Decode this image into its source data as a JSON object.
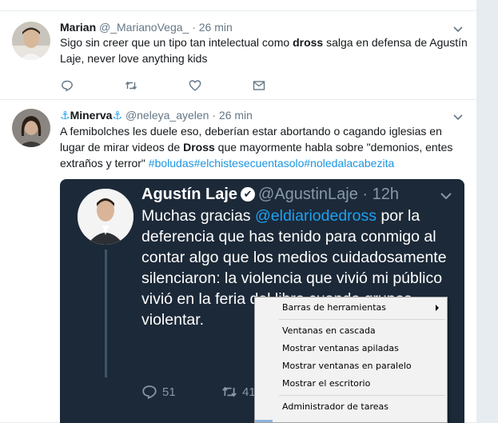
{
  "tweets": [
    {
      "name": "Marian",
      "handle": "@_MarianoVega_",
      "separator": "·",
      "time": "26 min",
      "text_pre": "Sigo sin creer que un tipo tan intelectual como ",
      "text_bold": "dross",
      "text_post": " salga en defensa de Agustín Laje, never love anything kids"
    },
    {
      "anchor_left": "⚓",
      "name": "Minerva",
      "anchor_right": "⚓",
      "handle": "@neleya_ayelen",
      "separator": "·",
      "time": "26 min",
      "text_pre": "A  femibolches les duele eso, deberían estar abortando o cagando iglesias en lugar de mirar videos de ",
      "text_bold": "Dross",
      "text_post": " que mayormente habla sobre \"demonios, entes extraños y terror\" ",
      "hashtags": [
        "#boludas",
        "#elchistesecuentasolo",
        "#noledalacabezita"
      ]
    }
  ],
  "embedded_tweet": {
    "name": "Agustín Laje",
    "verified_glyph": "✔",
    "handle": "@AgustinLaje",
    "separator": "·",
    "time": "12h",
    "text_pre": "Muchas gracias ",
    "mention": "@eldiariodedross",
    "text_post": " por la deferencia que has tenido para conmigo al contar algo que los medios cuidadosamente silenciaron: la violencia que vivió mi público vivió en la feria del libro cuando grupos violentar.",
    "reply_count": "51",
    "retweet_count": "41"
  },
  "context_menu": {
    "items": [
      {
        "label": "Barras de herramientas",
        "submenu": true
      },
      {
        "label": "Ventanas en cascada"
      },
      {
        "label": "Mostrar ventanas apiladas"
      },
      {
        "label": "Mostrar ventanas en paralelo"
      },
      {
        "label": "Mostrar el escritorio"
      },
      {
        "label": "Administrador de tareas"
      }
    ]
  },
  "colors": {
    "accent": "#1da1f2",
    "hashtag": "#1b95e0",
    "embed_bg": "#1c2938",
    "muted": "#657786"
  }
}
